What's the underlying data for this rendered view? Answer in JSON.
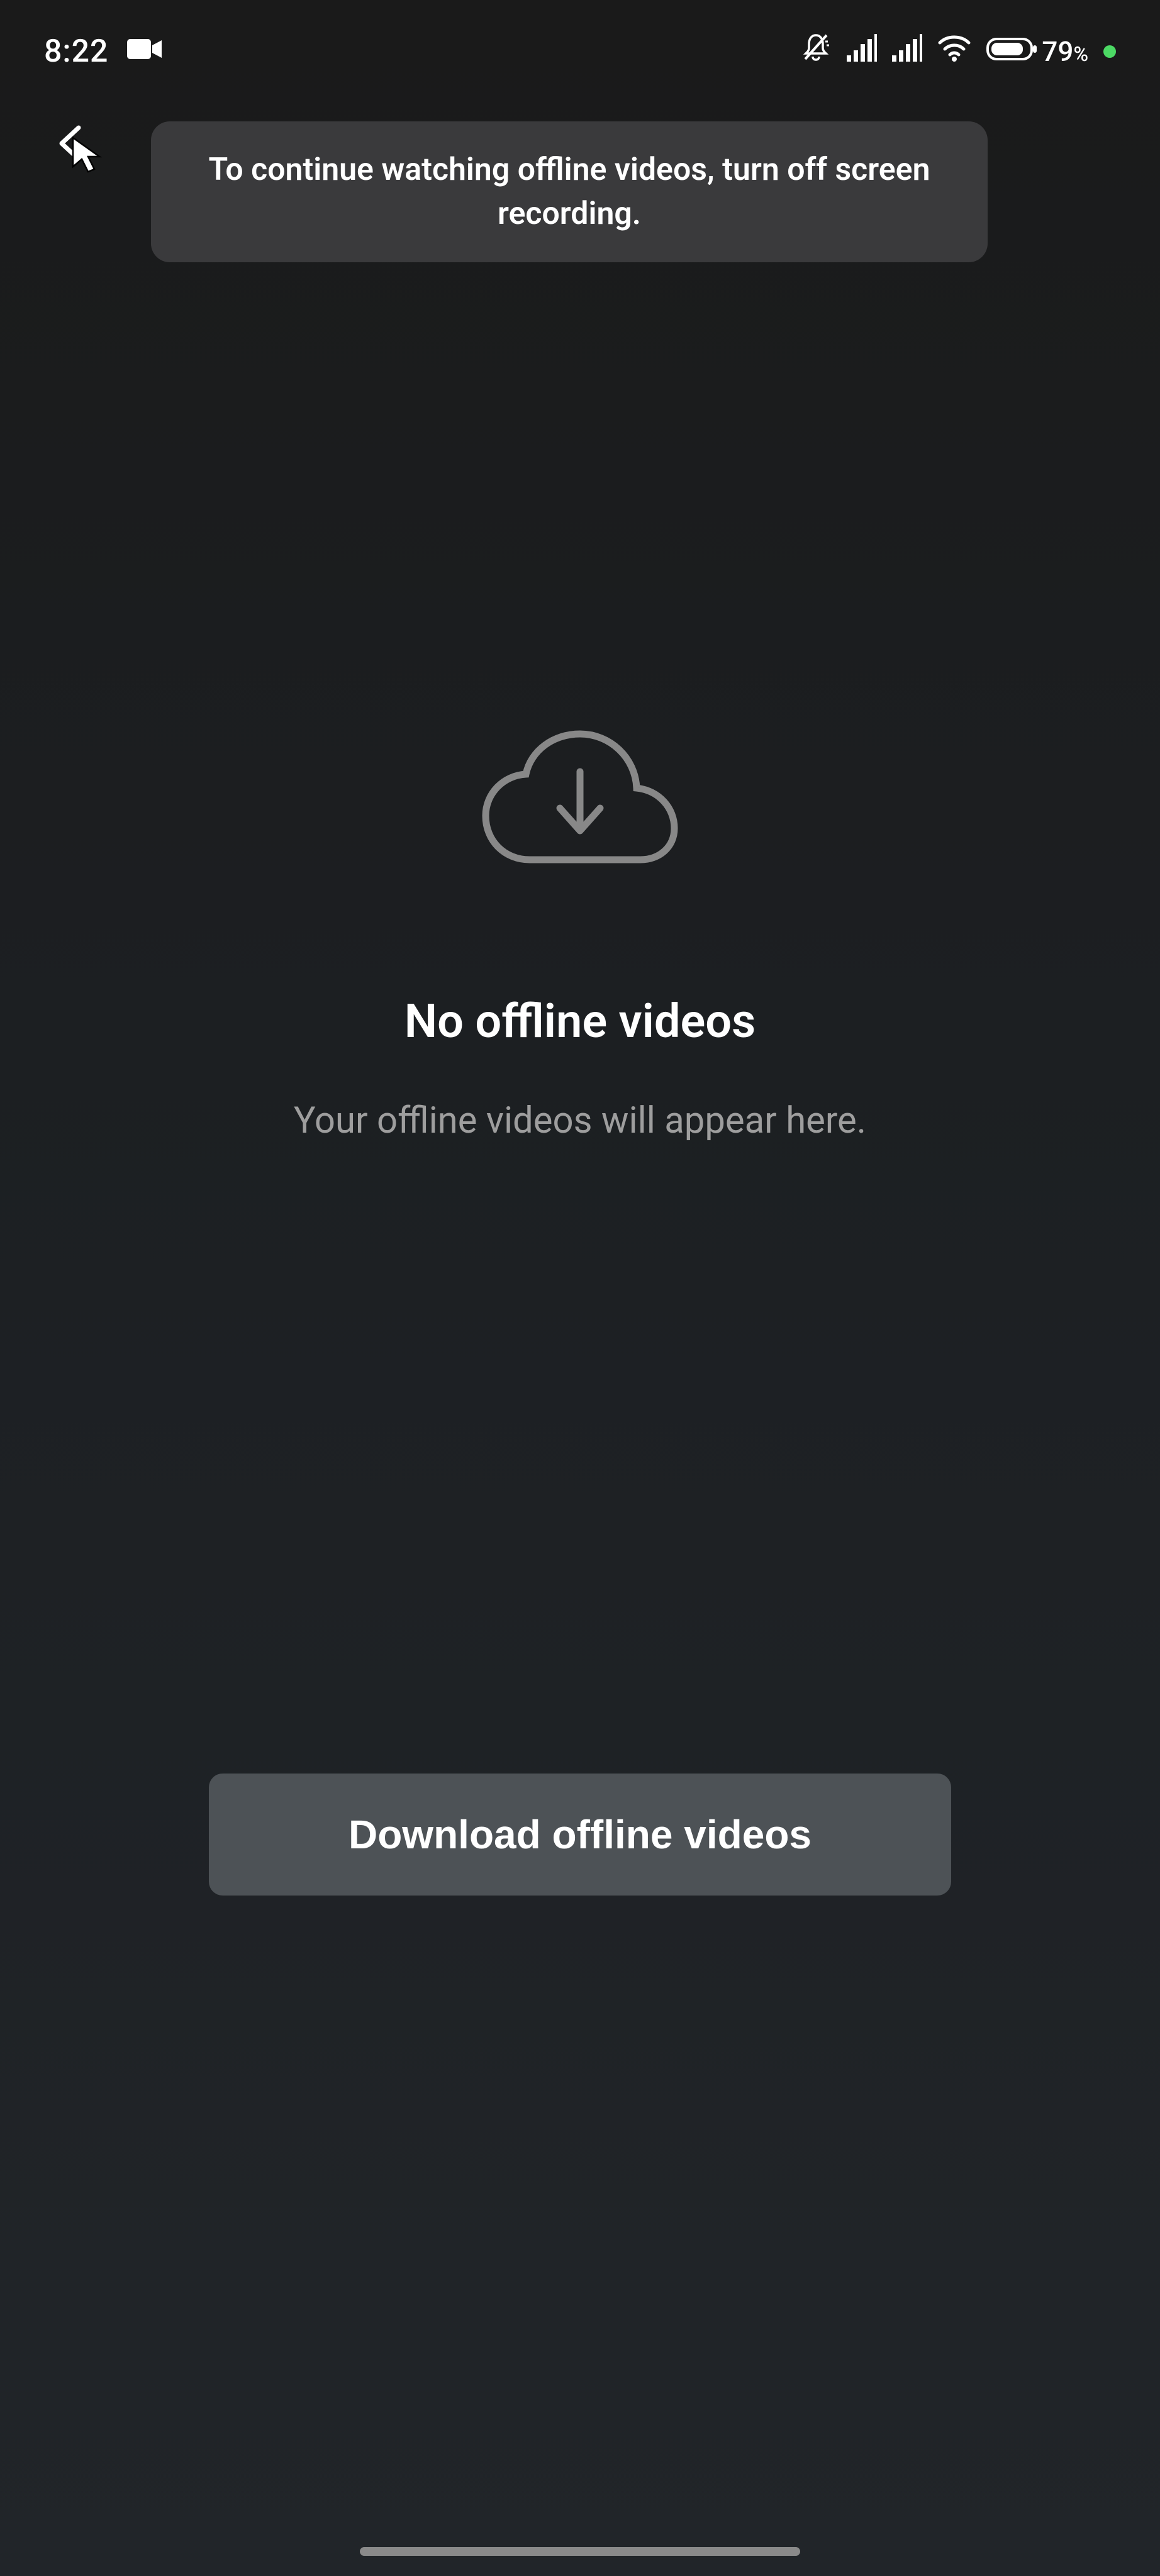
{
  "status_bar": {
    "time": "8:22",
    "battery_pct": "79",
    "battery_pct_sign": "%"
  },
  "toast": {
    "message": "To continue watching offline videos, turn off screen recording."
  },
  "empty_state": {
    "title": "No offline videos",
    "subtitle": "Your offline videos will appear here."
  },
  "download_button": {
    "label": "Download offline videos"
  }
}
